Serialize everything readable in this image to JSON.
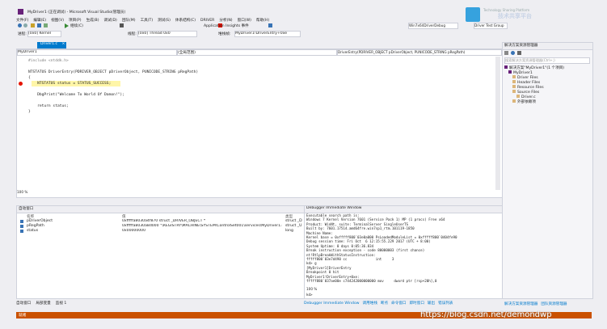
{
  "window": {
    "title": "MyDriver1 (正在调试) - Microsoft Visual Studio(管理员)",
    "logo_text": "Technology Sharing Platform",
    "logo_cn": "技术共享平台"
  },
  "menu": {
    "items": [
      "文件(F)",
      "编辑(E)",
      "视图(V)",
      "项目(P)",
      "生成(B)",
      "调试(D)",
      "团队(M)",
      "工具(T)",
      "测试(S)",
      "体系结构(C)",
      "DRIVER",
      "分析(N)",
      "窗口(W)",
      "帮助(H)"
    ]
  },
  "toolbar": {
    "continue_label": "继续(C)",
    "process_label": "进程:",
    "process_value": "[0x0] Kernel",
    "thread_label": "线程:",
    "thread_value": "[0x0] Thread 0x0",
    "stack_label": "堆栈帧:",
    "stack_value": "MyDriver1!DriverEntry+0xe",
    "app_insights": "Application Insights 事件",
    "target_value": "Win7x64DriverDebug",
    "device_group": "Driver Test Group"
  },
  "editor": {
    "tab_label": "Driver1.c",
    "tab_close": "×",
    "scope_left": "MyDriver1",
    "scope_mid": "(全局范围)",
    "scope_right": "DriverEntry(PDRIVER_OBJECT pDriverObject, PUNICODE_STRING pRegPath)",
    "lines": [
      "#include <ntddk.h>",
      "",
      "NTSTATUS DriverEntry(PDRIVER_OBJECT pDriverObject, PUNICODE_STRING pRegPath)",
      "{",
      "    NTSTATUS status = STATUS_SUCCESS;",
      "",
      "    DbgPrint(\"Welcome To World Of Damon!\");",
      "",
      "    return status;",
      "}"
    ],
    "zoom": "100 %"
  },
  "locals": {
    "title": "自动窗口",
    "columns": [
      "名称",
      "值",
      "类型"
    ],
    "rows": [
      {
        "name": "pDriverObject",
        "value": "0xfffffa8030a4f870 struct _DRIVER_OBJECT *",
        "type": "struct _D"
      },
      {
        "name": "pRegPath",
        "value": "0xfffffa8030a8d000 \"\\REGISTRY\\MACHINE\\SYSTEM\\ControlSet001\\services\\MyDriver1.sys\" struct _U",
        "type": "struct _U"
      },
      {
        "name": "status",
        "value": "0x00000000",
        "type": "long"
      }
    ],
    "tabs": [
      "自动窗口",
      "局部变量",
      "监视 1"
    ]
  },
  "immediate": {
    "title": "Debugger Immediate Window",
    "lines": [
      "Executable search path is:",
      "Windows 7 Kernel Version 7601 (Service Pack 1) MP (1 procs) Free x64",
      "Product: WinNt, suite: TerminalServer SingleUserTS",
      "Built by: 7601.17514.amd64fre.win7sp1_rtm.101119-1850",
      "Machine Name:",
      "Kernel base = 0xfffff800`03e0a000 PsLoadedModuleList = 0xfffff800`0404fe90",
      "Debug session time: Fri Oct  6 12:15:55.229 2017 (UTC + 8:00)",
      "System Uptime: 0 days 0:05:36.834",
      "Break instruction exception - code 80000003 (first chance)",
      "nt!RtlpBreakWithStatusInstruction:",
      "fffff800`03e7d490 cc              int     3",
      "kd> g",
      "[MyDriver1]DriverEntry",
      "Breakpoint 0 hit",
      "MyDriver1!DriverEntry+0xe:",
      "fffff880`037ae00e c744242000000000 mov     dword ptr [rsp+20h],0"
    ],
    "zoom": "100 %",
    "prompt": "kd>",
    "tabs": [
      "Debugger Immediate Window",
      "调用堆栈",
      "断点",
      "命令窗口",
      "即时窗口",
      "输出",
      "错误列表"
    ]
  },
  "solution": {
    "title": "解决方案资源管理器",
    "search_placeholder": "搜索解决方案资源管理器(Ctrl+;)",
    "items": [
      {
        "label": "解决方案\"MyDriver1\"(1 个项目)",
        "level": 0
      },
      {
        "label": "MyDriver1",
        "level": 1
      },
      {
        "label": "Driver Files",
        "level": 2
      },
      {
        "label": "Header Files",
        "level": 2
      },
      {
        "label": "Resource Files",
        "level": 2
      },
      {
        "label": "Source Files",
        "level": 2
      },
      {
        "label": "Driver.c",
        "level": 3
      },
      {
        "label": "外部依赖项",
        "level": 2
      }
    ],
    "bottom_tabs": [
      "解决方案资源管理器",
      "团队资源管理器"
    ]
  },
  "status": {
    "text": "就绪"
  },
  "watermark": "https://blog.csdn.net/demondwp"
}
